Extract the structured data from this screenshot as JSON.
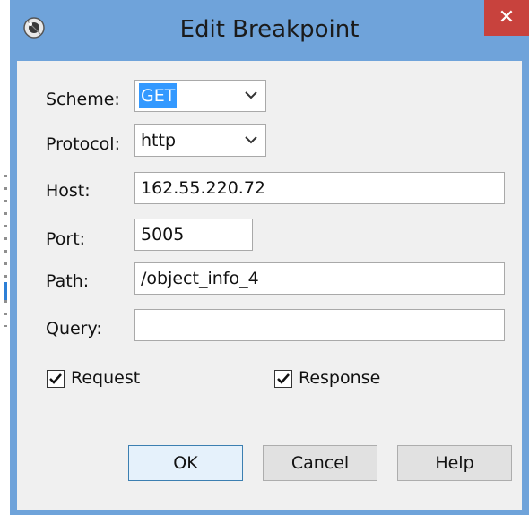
{
  "window": {
    "title": "Edit Breakpoint",
    "close_glyph": "✕"
  },
  "form": {
    "scheme": {
      "label": "Scheme:",
      "value": "GET"
    },
    "protocol": {
      "label": "Protocol:",
      "value": "http"
    },
    "host": {
      "label": "Host:",
      "value": "162.55.220.72"
    },
    "port": {
      "label": "Port:",
      "value": "5005"
    },
    "path": {
      "label": "Path:",
      "value": "/object_info_4"
    },
    "query": {
      "label": "Query:",
      "value": ""
    }
  },
  "options": {
    "request": {
      "label": "Request",
      "checked": true
    },
    "response": {
      "label": "Response",
      "checked": true
    }
  },
  "buttons": {
    "ok": "OK",
    "cancel": "Cancel",
    "help": "Help"
  },
  "colors": {
    "titlebar": "#6fa3da",
    "close": "#c8423d",
    "selection": "#3399ff"
  }
}
